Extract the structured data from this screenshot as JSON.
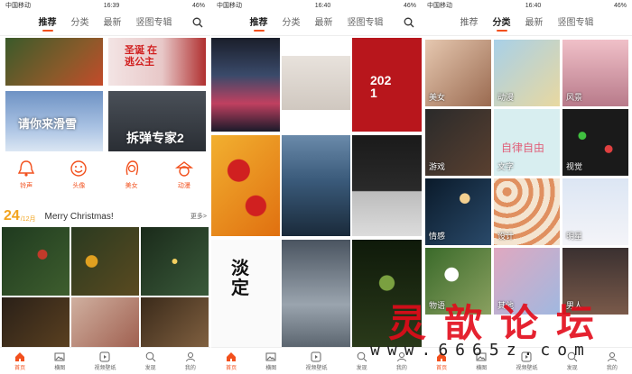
{
  "panels": [
    {
      "status": {
        "left": "中国移动",
        "time": "16:39",
        "right": "46%"
      },
      "tabs": [
        {
          "label": "推荐",
          "active": true
        },
        {
          "label": "分类"
        },
        {
          "label": "最新"
        },
        {
          "label": "竖图专辑"
        }
      ],
      "banners": [
        {
          "text": ""
        },
        {
          "text": "圣诞 在逃公主"
        },
        {
          "text": "请你来滑雪"
        },
        {
          "text": "拆弹专家2"
        }
      ],
      "categories": [
        {
          "label": "铃声",
          "icon": "bell-icon"
        },
        {
          "label": "头像",
          "icon": "smiley-face-icon"
        },
        {
          "label": "美女",
          "icon": "woman-icon"
        },
        {
          "label": "动漫",
          "icon": "anime-character-icon"
        }
      ],
      "date": {
        "day": "24",
        "month": "/12月",
        "title": "Merry Christmas!",
        "more": "更多>"
      }
    },
    {
      "status": {
        "left": "中国移动",
        "time": "16:40",
        "right": "46%"
      },
      "tabs": [
        {
          "label": "推荐",
          "active": true
        },
        {
          "label": "分类"
        },
        {
          "label": "最新"
        },
        {
          "label": "竖图专辑"
        }
      ],
      "tiles": [
        {
          "text": ""
        },
        {
          "text": ""
        },
        {
          "text": "2021"
        },
        {
          "text": ""
        },
        {
          "text": ""
        },
        {
          "text": ""
        },
        {
          "text": "淡定"
        },
        {
          "text": ""
        },
        {
          "text": ""
        }
      ]
    },
    {
      "status": {
        "left": "中国移动",
        "time": "16:40",
        "right": "46%"
      },
      "tabs": [
        {
          "label": "推荐"
        },
        {
          "label": "分类",
          "active": true
        },
        {
          "label": "最新"
        },
        {
          "label": "竖图专辑"
        }
      ],
      "tiles": [
        {
          "label": "美女"
        },
        {
          "label": "动漫"
        },
        {
          "label": "风景"
        },
        {
          "label": "游戏"
        },
        {
          "label": "文字"
        },
        {
          "label": "视觉"
        },
        {
          "label": "情感"
        },
        {
          "label": "设计"
        },
        {
          "label": "明星"
        },
        {
          "label": "物语"
        },
        {
          "label": "其他"
        },
        {
          "label": "男人"
        }
      ],
      "tile_center_text": "自律自由"
    }
  ],
  "bottom_nav": [
    {
      "label": "首页",
      "icon": "home-icon"
    },
    {
      "label": "横图",
      "icon": "image-icon"
    },
    {
      "label": "视频壁纸",
      "icon": "video-icon"
    },
    {
      "label": "发现",
      "icon": "discover-icon"
    },
    {
      "label": "我的",
      "icon": "profile-icon"
    }
  ],
  "watermark": {
    "text": "灵歆论坛",
    "url": "www.6665z.com"
  },
  "colors": {
    "accent": "#f2501d",
    "date": "#f2a31d"
  }
}
